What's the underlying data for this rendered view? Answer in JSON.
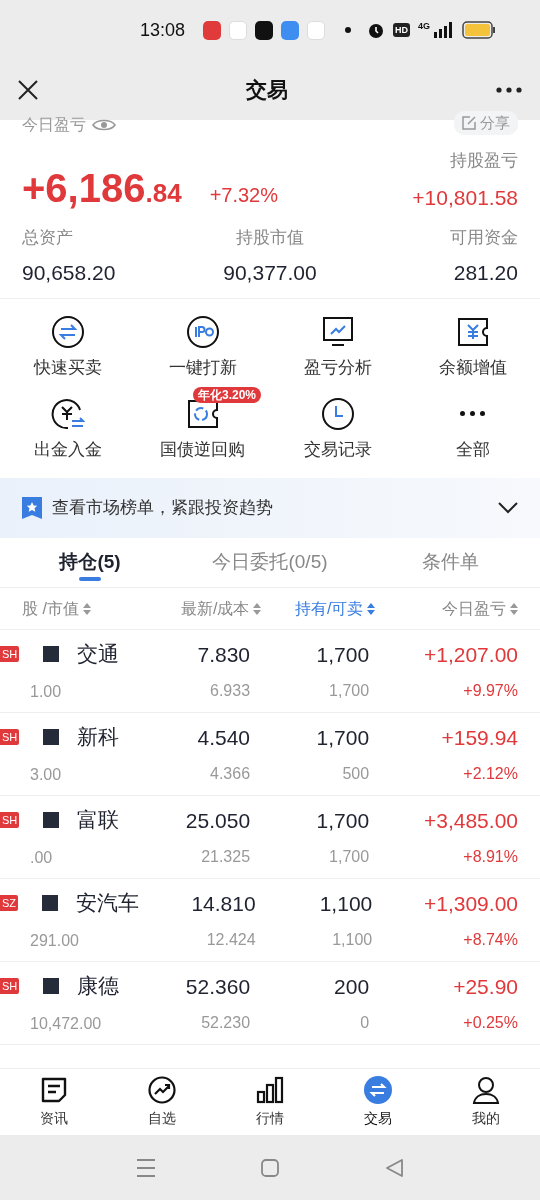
{
  "status_bar": {
    "time": "13:08",
    "hd": "HD",
    "network": "4G"
  },
  "nav": {
    "title": "交易"
  },
  "summary": {
    "today_label": "今日盈亏",
    "share": "分享",
    "today_pnl_int": "+6,186",
    "today_pnl_dec": ".84",
    "today_pct": "+7.32%",
    "holding_pnl_label": "持股盈亏",
    "holding_pnl": "+10,801.58",
    "stats": [
      {
        "label": "总资产",
        "value": "90,658.20"
      },
      {
        "label": "持股市值",
        "value": "90,377.00"
      },
      {
        "label": "可用资金",
        "value": "281.20"
      }
    ]
  },
  "shortcuts": [
    {
      "kind": "swap",
      "label": "快速买卖"
    },
    {
      "kind": "ipo",
      "label": "一键打新"
    },
    {
      "kind": "chart",
      "label": "盈亏分析"
    },
    {
      "kind": "yen-ticket",
      "label": "余额增值"
    },
    {
      "kind": "yen-swap",
      "label": "出金入金"
    },
    {
      "kind": "ticket",
      "label": "国债逆回购",
      "badge": "年化3.20%"
    },
    {
      "kind": "clock",
      "label": "交易记录"
    },
    {
      "kind": "more",
      "label": "全部"
    }
  ],
  "banner": {
    "text": "查看市场榜单，紧跟投资趋势"
  },
  "tabs": [
    {
      "label": "持仓(5)",
      "selected": true
    },
    {
      "label": "今日委托(0/5)",
      "selected": false
    },
    {
      "label": "条件单",
      "selected": false
    }
  ],
  "columns": [
    {
      "label": "股 /市值",
      "selected": false
    },
    {
      "label": "最新/成本",
      "selected": false
    },
    {
      "label": "持有/可卖",
      "selected": true
    },
    {
      "label": "今日盈亏",
      "selected": false
    }
  ],
  "rows": [
    {
      "market": "SH",
      "name": "交通",
      "value": "1.00",
      "price": "7.830",
      "cost": "6.933",
      "hold": "1,700",
      "sellable": "1,700",
      "pnl": "+1,207.00",
      "pnl_pct": "+9.97%"
    },
    {
      "market": "SH",
      "name": "新科",
      "value": "3.00",
      "price": "4.540",
      "cost": "4.366",
      "hold": "1,700",
      "sellable": "500",
      "pnl": "+159.94",
      "pnl_pct": "+2.12%"
    },
    {
      "market": "SH",
      "name": "富联",
      "value": ".00",
      "price": "25.050",
      "cost": "21.325",
      "hold": "1,700",
      "sellable": "1,700",
      "pnl": "+3,485.00",
      "pnl_pct": "+8.91%"
    },
    {
      "market": "SZ",
      "name": "安汽车",
      "value": "291.00",
      "price": "14.810",
      "cost": "12.424",
      "hold": "1,100",
      "sellable": "1,100",
      "pnl": "+1,309.00",
      "pnl_pct": "+8.74%"
    },
    {
      "market": "SH",
      "name": "康德",
      "value": "10,472.00",
      "price": "52.360",
      "cost": "52.230",
      "hold": "200",
      "sellable": "0",
      "pnl": "+25.90",
      "pnl_pct": "+0.25%"
    }
  ],
  "bottom_nav": [
    {
      "kind": "news",
      "label": "资讯",
      "selected": false
    },
    {
      "kind": "watch",
      "label": "自选",
      "selected": false
    },
    {
      "kind": "market",
      "label": "行情",
      "selected": false
    },
    {
      "kind": "trade",
      "label": "交易",
      "selected": true
    },
    {
      "kind": "me",
      "label": "我的",
      "selected": false
    }
  ]
}
